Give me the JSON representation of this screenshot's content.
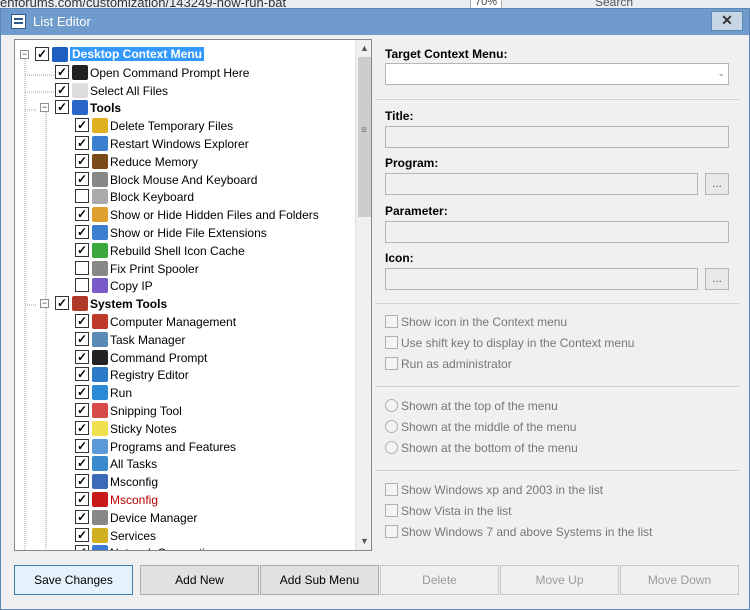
{
  "browser": {
    "url": "enforums.com/customization/143249-how-run-bat",
    "zoom": "70%",
    "search": "Search"
  },
  "window": {
    "title": "List Editor",
    "close_glyph": "✕"
  },
  "tree": [
    {
      "label": "Desktop Context Menu",
      "level": 0,
      "expander": "−",
      "checked": true,
      "icon": "desktop-icon",
      "color": "#1f5fbf",
      "style": "selected"
    },
    {
      "label": "Open Command Prompt Here",
      "level": 1,
      "checked": true,
      "icon": "cmd-icon",
      "color": "#222222"
    },
    {
      "label": "Select All Files",
      "level": 1,
      "checked": true,
      "icon": "file-icon",
      "color": "#dddddd"
    },
    {
      "label": "Tools",
      "level": 1,
      "expander": "−",
      "checked": true,
      "icon": "arrow-icon",
      "color": "#2a66c8",
      "style": "bold"
    },
    {
      "label": "Delete Temporary Files",
      "level": 2,
      "checked": true,
      "icon": "broom-icon",
      "color": "#e0b020"
    },
    {
      "label": "Restart Windows Explorer",
      "level": 2,
      "checked": true,
      "icon": "globe-icon",
      "color": "#3a7fd0"
    },
    {
      "label": "Reduce Memory",
      "level": 2,
      "checked": true,
      "icon": "memory-icon",
      "color": "#7a4a1a"
    },
    {
      "label": "Block Mouse And Keyboard",
      "level": 2,
      "checked": true,
      "icon": "keyboard-icon",
      "color": "#888888"
    },
    {
      "label": "Block Keyboard",
      "level": 2,
      "checked": false,
      "icon": "keyboard-icon",
      "color": "#aaaaaa"
    },
    {
      "label": "Show or Hide Hidden Files and Folders",
      "level": 2,
      "checked": true,
      "icon": "folder-icon",
      "color": "#e0a030"
    },
    {
      "label": "Show or Hide File Extensions",
      "level": 2,
      "checked": true,
      "icon": "extension-icon",
      "color": "#3a7fd0"
    },
    {
      "label": "Rebuild Shell Icon Cache",
      "level": 2,
      "checked": true,
      "icon": "refresh-icon",
      "color": "#3aa83a"
    },
    {
      "label": "Fix Print Spooler",
      "level": 2,
      "checked": false,
      "icon": "printer-icon",
      "color": "#888888"
    },
    {
      "label": "Copy IP",
      "level": 2,
      "checked": false,
      "icon": "network-icon",
      "color": "#7a5ac8"
    },
    {
      "label": "System Tools",
      "level": 1,
      "expander": "−",
      "checked": true,
      "icon": "hammer-icon",
      "color": "#b03a2a",
      "style": "bold"
    },
    {
      "label": "Computer Management",
      "level": 2,
      "checked": true,
      "icon": "computer-management-icon",
      "color": "#c03a2a"
    },
    {
      "label": "Task Manager",
      "level": 2,
      "checked": true,
      "icon": "task-manager-icon",
      "color": "#5a8ab8"
    },
    {
      "label": "Command Prompt",
      "level": 2,
      "checked": true,
      "icon": "cmd-icon",
      "color": "#222222"
    },
    {
      "label": "Registry Editor",
      "level": 2,
      "checked": true,
      "icon": "registry-icon",
      "color": "#2a7ac8"
    },
    {
      "label": "Run",
      "level": 2,
      "checked": true,
      "icon": "run-icon",
      "color": "#2a8ad8"
    },
    {
      "label": "Snipping Tool",
      "level": 2,
      "checked": true,
      "icon": "scissors-icon",
      "color": "#d84a4a"
    },
    {
      "label": "Sticky Notes",
      "level": 2,
      "checked": true,
      "icon": "note-icon",
      "color": "#f0e050"
    },
    {
      "label": "Programs and Features",
      "level": 2,
      "checked": true,
      "icon": "programs-icon",
      "color": "#5a9ad8"
    },
    {
      "label": "All Tasks",
      "level": 2,
      "checked": true,
      "icon": "control-panel-icon",
      "color": "#3a8ad0"
    },
    {
      "label": "Msconfig",
      "level": 2,
      "checked": true,
      "icon": "msconfig-icon",
      "color": "#3a6ab8"
    },
    {
      "label": "Msconfig",
      "level": 2,
      "checked": true,
      "icon": "x-icon",
      "color": "#c81a1a",
      "style": "red"
    },
    {
      "label": "Device Manager",
      "level": 2,
      "checked": true,
      "icon": "device-manager-icon",
      "color": "#888888"
    },
    {
      "label": "Services",
      "level": 2,
      "checked": true,
      "icon": "services-icon",
      "color": "#d0b020"
    },
    {
      "label": "Network Connections",
      "level": 2,
      "checked": true,
      "icon": "network-connections-icon",
      "color": "#3a7ad0"
    }
  ],
  "scrollbar": {
    "up": "▲",
    "down": "▼",
    "grip": "≡"
  },
  "form": {
    "target_label": "Target Context Menu:",
    "target_value": "",
    "target_arrow": "⌄",
    "title_label": "Title:",
    "program_label": "Program:",
    "parameter_label": "Parameter:",
    "icon_label": "Icon:",
    "browse_label": "...",
    "checks": [
      "Show icon in the Context menu",
      "Use shift key to display in the Context menu",
      "Run as administrator"
    ],
    "radios": [
      "Shown at the top of the menu",
      "Shown at the middle of the menu",
      "Shown at the bottom of the menu"
    ],
    "systems": [
      "Show Windows xp  and 2003 in the list",
      "Show Vista in the list",
      "Show Windows 7 and above Systems in the list"
    ]
  },
  "buttons": {
    "save": "Save Changes",
    "add_new": "Add New",
    "add_sub_menu": "Add Sub Menu",
    "delete": "Delete",
    "move_up": "Move Up",
    "move_down": "Move Down"
  }
}
